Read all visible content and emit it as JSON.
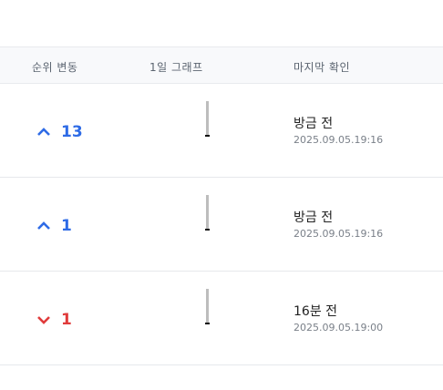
{
  "header": {
    "rank_change": "순위 변동",
    "graph": "1일 그래프",
    "last_check": "마지막 확인"
  },
  "rows": [
    {
      "direction": "up",
      "rank_change": "13",
      "relative_time": "방금 전",
      "timestamp": "2025.09.05.19:16"
    },
    {
      "direction": "up",
      "rank_change": "1",
      "relative_time": "방금 전",
      "timestamp": "2025.09.05.19:16"
    },
    {
      "direction": "down",
      "rank_change": "1",
      "relative_time": "16분 전",
      "timestamp": "2025.09.05.19:00"
    }
  ],
  "colors": {
    "up": "#2e6be6",
    "down": "#e03b3b"
  },
  "icons": {
    "up": "chevron-up-icon",
    "down": "chevron-down-icon"
  }
}
